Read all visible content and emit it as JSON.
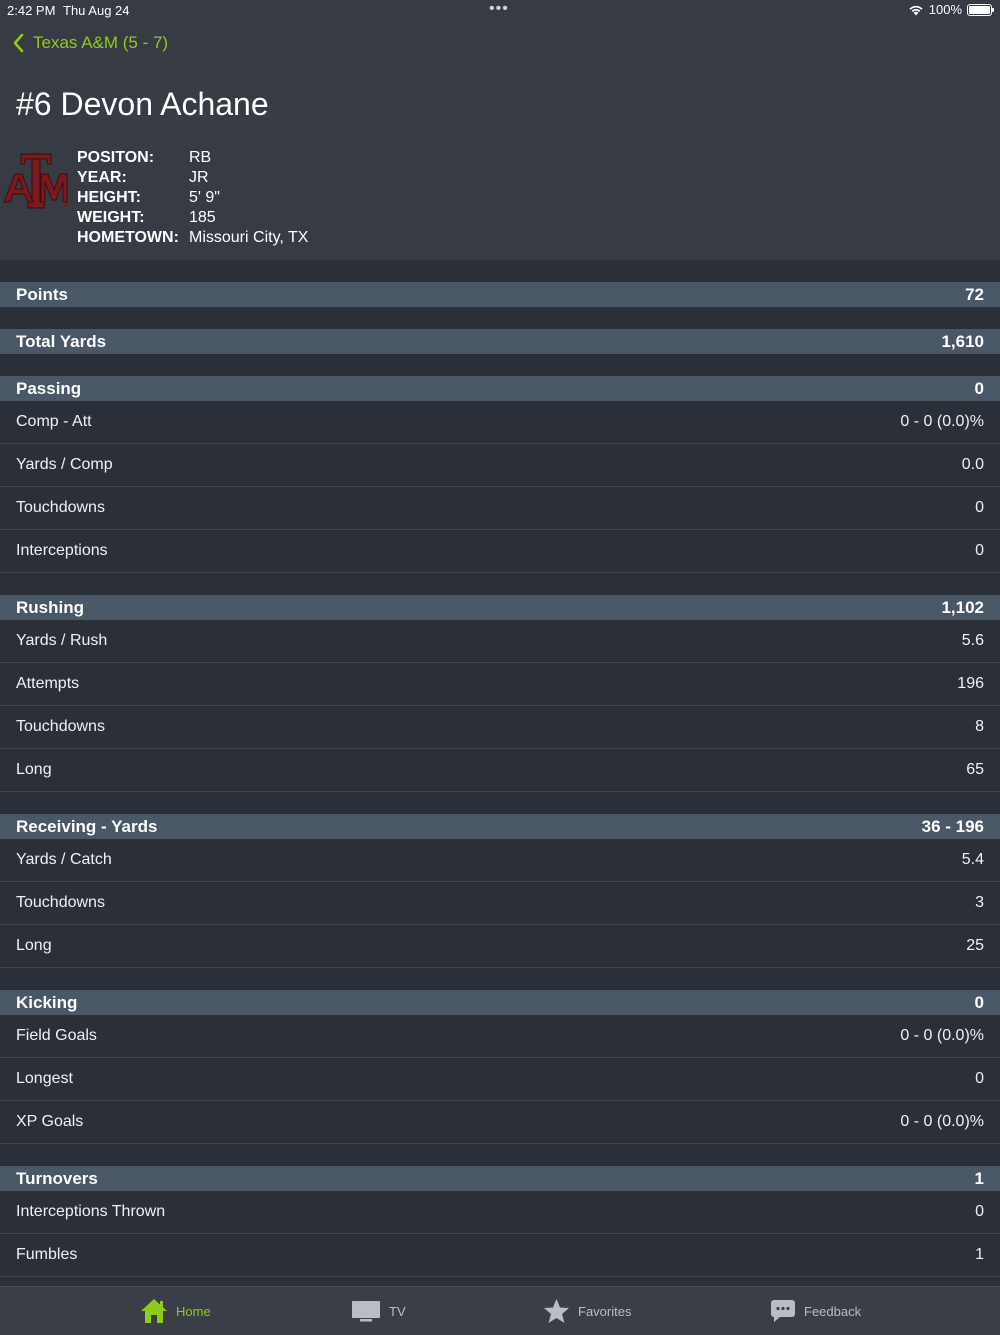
{
  "status_bar": {
    "time": "2:42 PM",
    "date": "Thu Aug 24",
    "battery": "100%"
  },
  "nav": {
    "back_label": "Texas A&M (5 - 7)"
  },
  "player": {
    "name": "#6 Devon Achane",
    "logo_text": "ATM",
    "info": [
      {
        "label": "POSITON:",
        "value": "RB"
      },
      {
        "label": "YEAR:",
        "value": "JR"
      },
      {
        "label": "HEIGHT:",
        "value": "5' 9\""
      },
      {
        "label": "WEIGHT:",
        "value": "185"
      },
      {
        "label": "HOMETOWN:",
        "value": "Missouri City, TX"
      }
    ]
  },
  "sections": [
    {
      "title": "Points",
      "value": "72",
      "rows": []
    },
    {
      "title": "Total Yards",
      "value": "1,610",
      "rows": []
    },
    {
      "title": "Passing",
      "value": "0",
      "rows": [
        {
          "label": "Comp - Att",
          "value": "0 - 0 (0.0)%"
        },
        {
          "label": "Yards / Comp",
          "value": "0.0"
        },
        {
          "label": "Touchdowns",
          "value": "0"
        },
        {
          "label": "Interceptions",
          "value": "0"
        }
      ]
    },
    {
      "title": "Rushing",
      "value": "1,102",
      "rows": [
        {
          "label": "Yards / Rush",
          "value": "5.6"
        },
        {
          "label": "Attempts",
          "value": "196"
        },
        {
          "label": "Touchdowns",
          "value": "8"
        },
        {
          "label": "Long",
          "value": "65"
        }
      ]
    },
    {
      "title": "Receiving - Yards",
      "value": "36 - 196",
      "rows": [
        {
          "label": "Yards / Catch",
          "value": "5.4"
        },
        {
          "label": "Touchdowns",
          "value": "3"
        },
        {
          "label": "Long",
          "value": "25"
        }
      ]
    },
    {
      "title": "Kicking",
      "value": "0",
      "rows": [
        {
          "label": "Field Goals",
          "value": "0 - 0 (0.0)%"
        },
        {
          "label": "Longest",
          "value": "0"
        },
        {
          "label": "XP Goals",
          "value": "0 - 0 (0.0)%"
        }
      ]
    },
    {
      "title": "Turnovers",
      "value": "1",
      "rows": [
        {
          "label": "Interceptions Thrown",
          "value": "0"
        },
        {
          "label": "Fumbles",
          "value": "1"
        }
      ]
    }
  ],
  "tabs": [
    {
      "label": "Home",
      "icon": "home-icon",
      "active": true
    },
    {
      "label": "TV",
      "icon": "tv-icon",
      "active": false
    },
    {
      "label": "Favorites",
      "icon": "star-icon",
      "active": false
    },
    {
      "label": "Feedback",
      "icon": "chat-icon",
      "active": false
    }
  ],
  "colors": {
    "accent": "#8fcb1d",
    "section_header": "#4a5766",
    "background": "#2b2f37",
    "header_bg": "#363b44",
    "logo": "#7a1a1c"
  }
}
